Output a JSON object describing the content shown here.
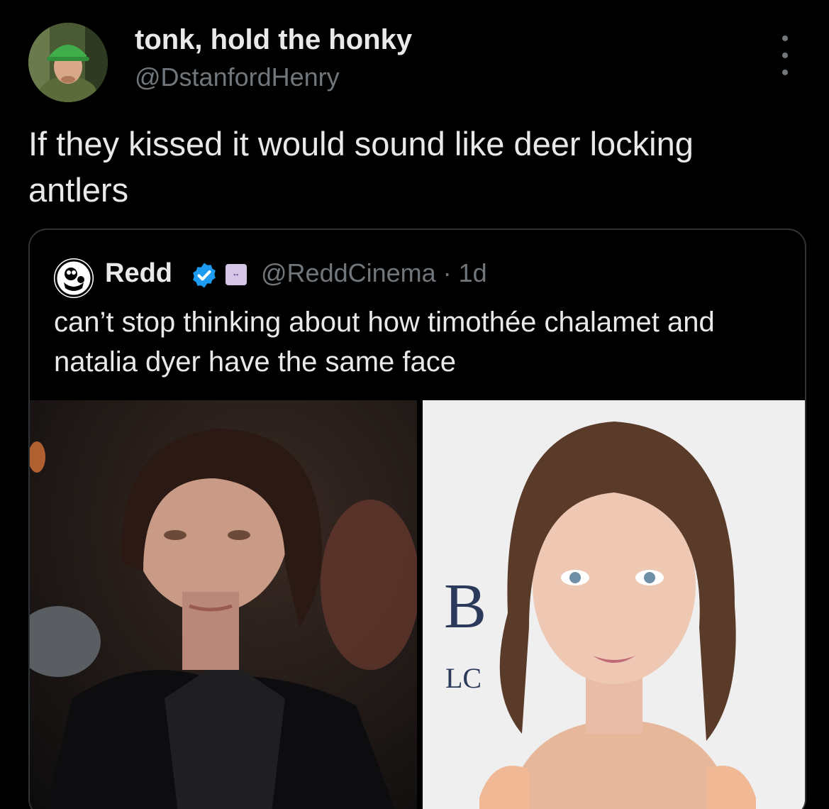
{
  "tweet": {
    "display_name": "tonk, hold the honky",
    "handle": "@DstanfordHenry",
    "text": "If they kissed it would sound like deer locking antlers",
    "avatar_icon": "profile-photo"
  },
  "quoted_tweet": {
    "display_name": "Redd",
    "handle_time": "@ReddCinema · 1d",
    "text": "can’t stop thinking about how timothée chalamet and natalia dyer have the same face",
    "verified_icon": "verified-badge-icon",
    "affiliate_icon": "affiliate-badge-icon",
    "backdrop_letters": [
      "B",
      "LC"
    ]
  },
  "colors": {
    "background": "#000000",
    "text_primary": "#e7e9ea",
    "text_secondary": "#71767b",
    "border": "#2f3336",
    "verified_blue": "#1d9bf0"
  }
}
